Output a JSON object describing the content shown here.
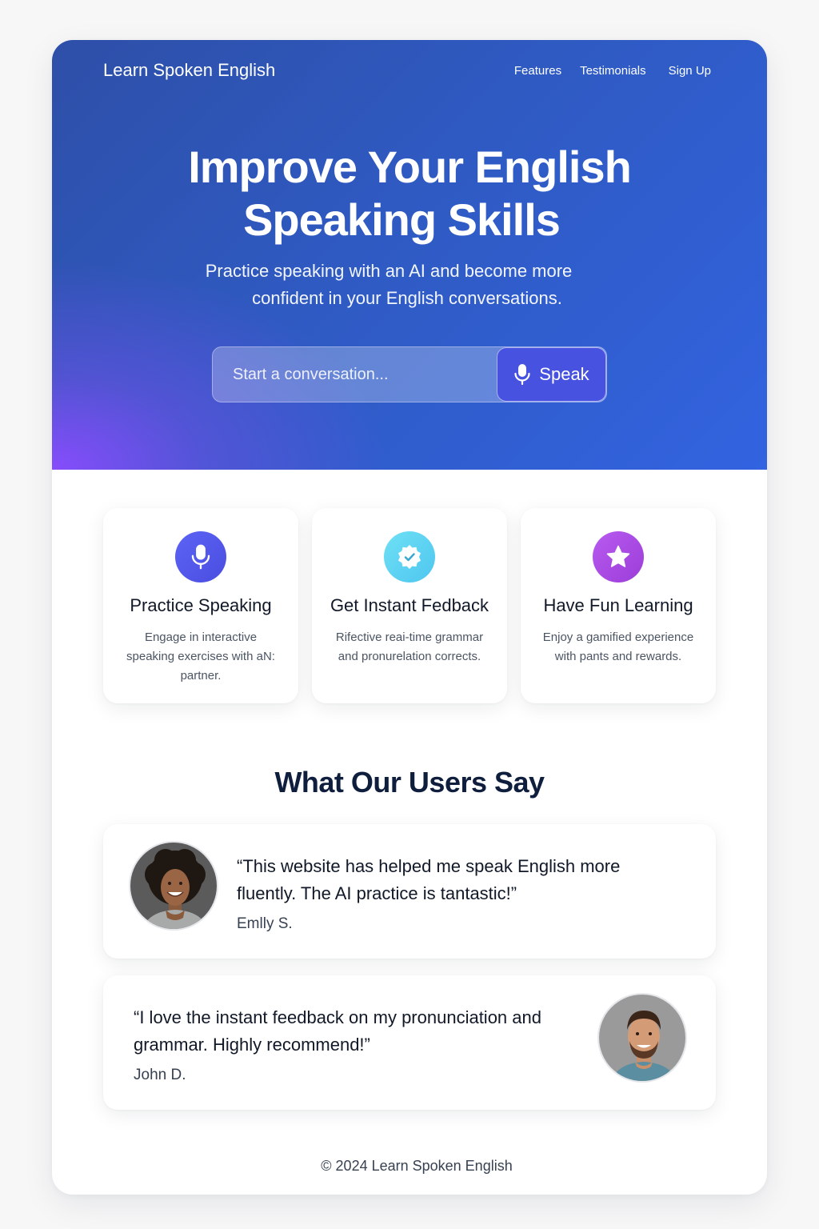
{
  "header": {
    "brand": "Learn Spoken English",
    "nav": [
      "Features",
      "Testimonials",
      "Sign Up"
    ]
  },
  "hero": {
    "title_line1": "Improve Your English",
    "title_line2": "Speaking Skills",
    "subtitle_line1": "Practice speaking with an AI and become more",
    "subtitle_line2": "confident in your English conversations.",
    "input_placeholder": "Start a conversation...",
    "speak_label": "Speak"
  },
  "features": [
    {
      "icon": "microphone-icon",
      "title": "Practice Speaking",
      "description": "Engage in interactive speaking exercises with aN: partner."
    },
    {
      "icon": "check-badge-icon",
      "title": "Get Instant Fedback",
      "description": "Rifective reai-time grammar and pronurelation corrects."
    },
    {
      "icon": "star-icon",
      "title": "Have Fun Learning",
      "description": "Enjoy a gamified experience with pants and rewards."
    }
  ],
  "testimonials_section": {
    "title": "What Our Users Say",
    "items": [
      {
        "quote": "“This website has helped me speak English more fluently. The AI practice is tantastic!”",
        "author": "Emlly S."
      },
      {
        "quote": "“I love the instant feedback on my pronunciation and grammar. Highly recommend!”",
        "author": "John D."
      }
    ]
  },
  "footer": {
    "text": "© 2024 Learn Spoken English"
  },
  "colors": {
    "hero_blue": "#2f5ac2",
    "hero_purple": "#8b4cff",
    "speak_button": "#4752e0",
    "heading_navy": "#0f1e3d"
  }
}
